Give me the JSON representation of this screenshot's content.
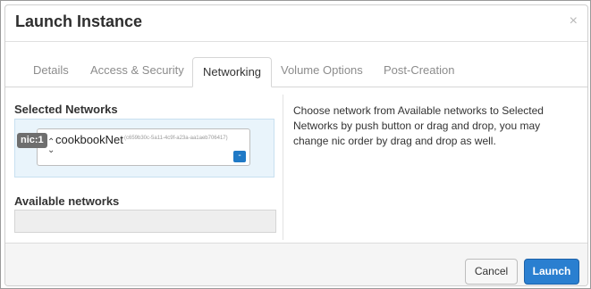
{
  "modal": {
    "title": "Launch Instance",
    "close_glyph": "×"
  },
  "tabs": [
    {
      "label": "Details",
      "active": false
    },
    {
      "label": "Access & Security",
      "active": false
    },
    {
      "label": "Networking",
      "active": true
    },
    {
      "label": "Volume Options",
      "active": false
    },
    {
      "label": "Post-Creation",
      "active": false
    }
  ],
  "networking": {
    "selected_label": "Selected Networks",
    "selected": [
      {
        "nic": "nic:1",
        "name": "cookbookNet",
        "id": "(c659b30c-5a11-4c9f-a23a-aa1aeb706417)",
        "remove_glyph": "-"
      }
    ],
    "available_label": "Available networks",
    "help_text": "Choose network from Available networks to Selected Networks by push button or drag and drop, you may change nic order by drag and drop as well."
  },
  "footer": {
    "cancel_label": "Cancel",
    "launch_label": "Launch"
  },
  "colors": {
    "accent": "#2a7fd0",
    "selected_bg": "#e9f4fb"
  },
  "icons": {
    "close": "close-icon",
    "sort": "sort-arrows-icon",
    "remove": "minus-icon"
  }
}
